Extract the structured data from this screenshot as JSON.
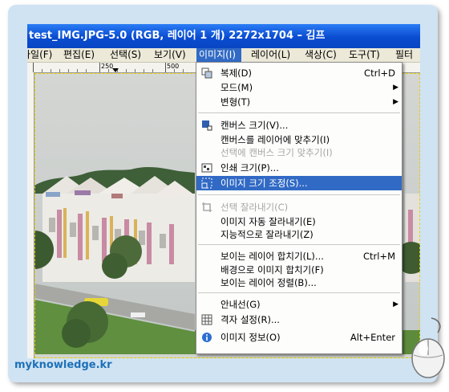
{
  "window": {
    "title": "test_IMG.JPG-5.0 (RGB, 레이어 1 개) 2272x1704 – 김프"
  },
  "menubar": [
    {
      "label": "파일(F)",
      "active": false
    },
    {
      "label": "편집(E)",
      "active": false
    },
    {
      "label": "선택(S)",
      "active": false
    },
    {
      "label": "보기(V)",
      "active": false
    },
    {
      "label": "이미지(I)",
      "active": true
    },
    {
      "label": "레이어(L)",
      "active": false
    },
    {
      "label": "색상(C)",
      "active": false
    },
    {
      "label": "도구(T)",
      "active": false
    },
    {
      "label": "필터",
      "active": false
    }
  ],
  "ruler": {
    "labels": [
      "250",
      "500"
    ]
  },
  "menu": {
    "duplicate": {
      "label": "복제(D)",
      "shortcut": "Ctrl+D"
    },
    "mode": {
      "label": "모드(M)"
    },
    "transform": {
      "label": "변형(T)"
    },
    "canvas_size": {
      "label": "캔버스 크기(V)..."
    },
    "fit_canvas_to_layers": {
      "label": "캔버스를 레이어에 맞추기(I)"
    },
    "canvas_to_selection": {
      "label": "선택에 캔버스 크기 맞추기(I)"
    },
    "print_size": {
      "label": "인쇄 크기(P)..."
    },
    "scale_image": {
      "label": "이미지 크기 조정(S)..."
    },
    "crop_to_selection": {
      "label": "선택 잘라내기(C)"
    },
    "autocrop": {
      "label": "이미지 자동 잘라내기(E)"
    },
    "zealous_crop": {
      "label": "지능적으로 잘라내기(Z)"
    },
    "merge_visible": {
      "label": "보이는 레이어 합치기(L)...",
      "shortcut": "Ctrl+M"
    },
    "flatten": {
      "label": "배경으로 이미지 합치기(F)"
    },
    "align_visible": {
      "label": "보이는 레이어 정렬(B)..."
    },
    "guides": {
      "label": "안내선(G)"
    },
    "configure_grid": {
      "label": "격자 설정(R)..."
    },
    "image_properties": {
      "label": "이미지 정보(O)",
      "shortcut": "Alt+Enter"
    }
  },
  "footer": {
    "brand": "myknowledge.kr"
  },
  "icons": [
    "duplicate-icon",
    "canvas-size-icon",
    "print-size-icon",
    "scale-image-icon",
    "crop-icon",
    "grid-icon",
    "info-icon",
    "submenu-arrow-icon",
    "mouse-icon"
  ],
  "colors": {
    "titlebar": "#0a4cd0",
    "highlight": "#316ac5",
    "menu_bg": "#fdfdfb",
    "frame": "#cfe3f3",
    "brand": "#1d70b8"
  }
}
